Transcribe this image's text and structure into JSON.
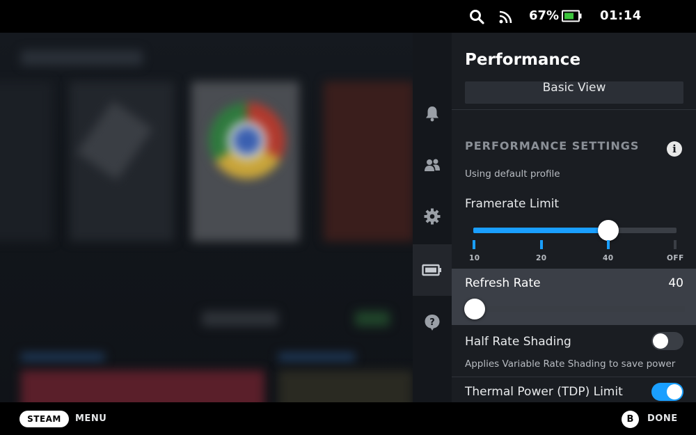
{
  "status_bar": {
    "battery_percent": "67%",
    "time": "01:14",
    "icons": [
      "search-icon",
      "wifi-icon",
      "battery-icon"
    ]
  },
  "rail": {
    "items": [
      {
        "icon": "bell-icon",
        "label": "notifications"
      },
      {
        "icon": "friends-icon",
        "label": "friends"
      },
      {
        "icon": "gear-icon",
        "label": "settings"
      },
      {
        "icon": "battery-icon",
        "label": "performance",
        "active": true
      },
      {
        "icon": "help-icon",
        "label": "help"
      }
    ]
  },
  "panel": {
    "title": "Performance",
    "basic_view_label": "Basic View",
    "section_title": "PERFORMANCE SETTINGS",
    "info_glyph": "i",
    "profile_text": "Using default profile",
    "framerate": {
      "label": "Framerate Limit",
      "ticks": [
        "10",
        "20",
        "40",
        "OFF"
      ],
      "selected": "40",
      "selected_index": 2
    },
    "refresh_rate": {
      "label": "Refresh Rate",
      "value": "40",
      "slider_fraction": 0.0
    },
    "half_rate_shading": {
      "label": "Half Rate Shading",
      "description": "Applies Variable Rate Shading to save power",
      "enabled": false
    },
    "tdp": {
      "label": "Thermal Power (TDP) Limit",
      "enabled": true
    }
  },
  "bottom_bar": {
    "steam_label": "STEAM",
    "menu_label": "MENU",
    "b_glyph": "B",
    "done_label": "DONE"
  },
  "colors": {
    "accent": "#1a9fff",
    "panel_bg": "#1a1d22",
    "highlight_row": "#3b3f47",
    "battery_green": "#3cc43c"
  }
}
